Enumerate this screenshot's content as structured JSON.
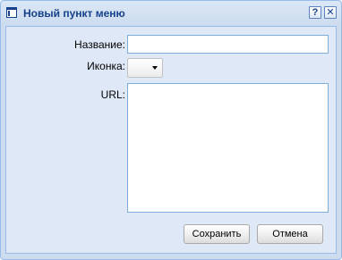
{
  "window": {
    "title": "Новый пункт меню",
    "help_button": "?",
    "close_button": "✕"
  },
  "form": {
    "name_label": "Название:",
    "name_value": "",
    "icon_label": "Иконка:",
    "url_label": "URL:",
    "url_value": ""
  },
  "buttons": {
    "save": "Сохранить",
    "cancel": "Отмена"
  },
  "colors": {
    "title_text": "#15428b",
    "window_border": "#99bbe8",
    "panel_bg": "#dfe8f6"
  }
}
